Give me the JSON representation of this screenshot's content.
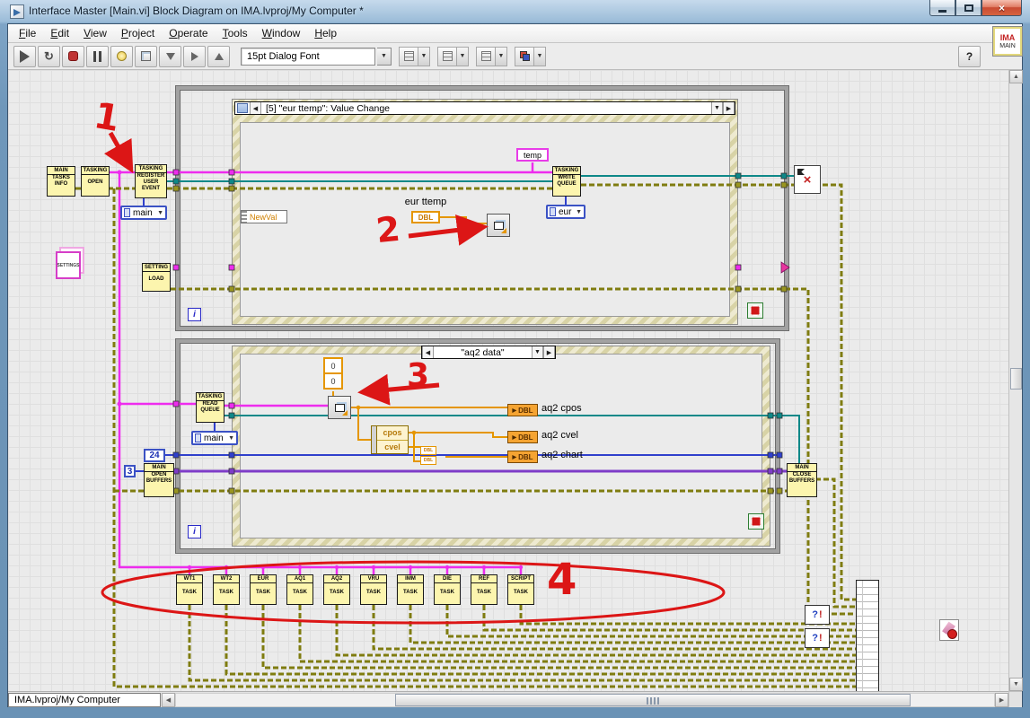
{
  "window": {
    "title": "Interface Master [Main.vi] Block Diagram on IMA.lvproj/My Computer *"
  },
  "menu": {
    "items": [
      "File",
      "Edit",
      "View",
      "Project",
      "Operate",
      "Tools",
      "Window",
      "Help"
    ]
  },
  "toolbar": {
    "font_selector": "15pt Dialog Font"
  },
  "vi_icon": {
    "line1": "IMA",
    "line2": "MAIN"
  },
  "icons": {
    "arrow_left": "◀",
    "arrow_right": "▶",
    "arrow_up": "▲",
    "arrow_down": "▼",
    "dropdown": "▼",
    "close": "×",
    "question": "?",
    "loop": "↻"
  },
  "diagram": {
    "top_loop": {
      "event_header": "[5] \"eur ttemp\": Value Change",
      "iteration": "i"
    },
    "bottom_loop": {
      "case_header": "\"aq2 data\"",
      "iteration": "i"
    },
    "nodes": {
      "tasks_info": {
        "header": "MAIN",
        "line1": "TASKS",
        "line2": "INFO"
      },
      "tasking_open": {
        "header": "TASKING",
        "line1": "OPEN"
      },
      "register_user_event": {
        "header": "TASKING",
        "line1": "REGISTER",
        "line2": "USER",
        "line3": "EVENT"
      },
      "main_enum_top": "main",
      "settings_cube": "SETTINGS",
      "setting_load": {
        "header": "SETTING",
        "line1": "LOAD"
      },
      "newval": "NewVal",
      "temp_label": "temp",
      "eur_ttemp_label": "eur ttemp",
      "dbl_terminal": "DBL",
      "write_queue": {
        "header": "TASKING",
        "line1": "WRITE",
        "line2": "QUEUE"
      },
      "eur_enum": "eur",
      "read_queue": {
        "header": "TASKING",
        "line1": "READ",
        "line2": "QUEUE"
      },
      "main_enum_bottom": "main",
      "array_const": {
        "cell1": "0",
        "cell2": "0"
      },
      "unbundle": {
        "row1": "cpos",
        "row2": "cvel"
      },
      "dbl_convert": {
        "top": "DBL",
        "bottom": "DBL"
      },
      "const_24": "24",
      "const_3": "3",
      "open_buffers": {
        "header": "MAIN",
        "line1": "OPEN",
        "line2": "BUFFERS"
      },
      "close_buffers": {
        "header": "MAIN",
        "line1": "CLOSE",
        "line2": "BUFFERS"
      },
      "indicators": [
        {
          "terminal": "DBL",
          "label": "aq2 cpos"
        },
        {
          "terminal": "DBL",
          "label": "aq2 cvel"
        },
        {
          "terminal": "DBL",
          "label": "aq2 chart"
        }
      ],
      "error_handler": {
        "glyph1": "?",
        "glyph2": "!"
      }
    },
    "tasks": [
      {
        "line1": "WT1",
        "line2": "TASK"
      },
      {
        "line1": "WT2",
        "line2": "TASK"
      },
      {
        "line1": "EUR",
        "line2": "TASK"
      },
      {
        "line1": "AQ1",
        "line2": "TASK"
      },
      {
        "line1": "AQ2",
        "line2": "TASK"
      },
      {
        "line1": "VRU",
        "line2": "TASK"
      },
      {
        "line1": "IMM",
        "line2": "TASK"
      },
      {
        "line1": "DIE",
        "line2": "TASK"
      },
      {
        "line1": "REF",
        "line2": "TASK"
      },
      {
        "line1": "SCRIPT",
        "line2": "TASK"
      }
    ],
    "annotations": {
      "n1": "1",
      "n2": "2",
      "n3": "3",
      "n4": "4"
    }
  },
  "statusbar": {
    "tab": "IMA.lvproj/My Computer"
  }
}
